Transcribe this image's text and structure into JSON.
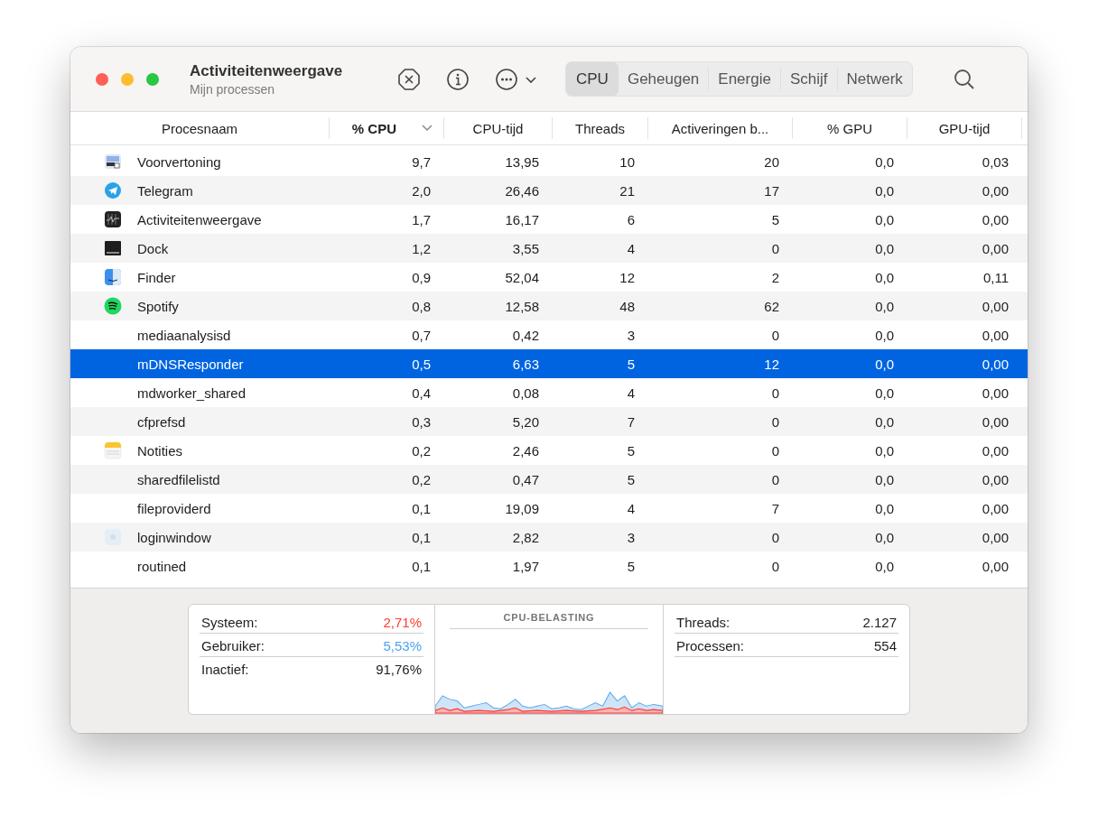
{
  "window": {
    "title": "Activiteitenweergave",
    "subtitle": "Mijn processen"
  },
  "tabs": [
    {
      "label": "CPU",
      "selected": true
    },
    {
      "label": "Geheugen",
      "selected": false
    },
    {
      "label": "Energie",
      "selected": false
    },
    {
      "label": "Schijf",
      "selected": false
    },
    {
      "label": "Netwerk",
      "selected": false
    }
  ],
  "table": {
    "columns": [
      {
        "label": "Procesnaam",
        "sorted": false
      },
      {
        "label": "% CPU",
        "sorted": true
      },
      {
        "label": "CPU-tijd",
        "sorted": false
      },
      {
        "label": "Threads",
        "sorted": false
      },
      {
        "label": "Activeringen b...",
        "sorted": false
      },
      {
        "label": "% GPU",
        "sorted": false
      },
      {
        "label": "GPU-tijd",
        "sorted": false
      }
    ],
    "rows": [
      {
        "kind": "preview",
        "selected": false,
        "cells": [
          "Voorvertoning",
          "9,7",
          "13,95",
          "10",
          "20",
          "0,0",
          "0,03"
        ]
      },
      {
        "kind": "telegram",
        "selected": false,
        "cells": [
          "Telegram",
          "2,0",
          "26,46",
          "21",
          "17",
          "0,0",
          "0,00"
        ]
      },
      {
        "kind": "activity",
        "selected": false,
        "cells": [
          "Activiteitenweergave",
          "1,7",
          "16,17",
          "6",
          "5",
          "0,0",
          "0,00"
        ]
      },
      {
        "kind": "dock",
        "selected": false,
        "cells": [
          "Dock",
          "1,2",
          "3,55",
          "4",
          "0",
          "0,0",
          "0,00"
        ]
      },
      {
        "kind": "finder",
        "selected": false,
        "cells": [
          "Finder",
          "0,9",
          "52,04",
          "12",
          "2",
          "0,0",
          "0,11"
        ]
      },
      {
        "kind": "spotify",
        "selected": false,
        "cells": [
          "Spotify",
          "0,8",
          "12,58",
          "48",
          "62",
          "0,0",
          "0,00"
        ]
      },
      {
        "kind": "plain",
        "selected": false,
        "cells": [
          "mediaanalysisd",
          "0,7",
          "0,42",
          "3",
          "0",
          "0,0",
          "0,00"
        ]
      },
      {
        "kind": "plain",
        "selected": true,
        "cells": [
          "mDNSResponder",
          "0,5",
          "6,63",
          "5",
          "12",
          "0,0",
          "0,00"
        ]
      },
      {
        "kind": "plain",
        "selected": false,
        "cells": [
          "mdworker_shared",
          "0,4",
          "0,08",
          "4",
          "0",
          "0,0",
          "0,00"
        ]
      },
      {
        "kind": "plain",
        "selected": false,
        "cells": [
          "cfprefsd",
          "0,3",
          "5,20",
          "7",
          "0",
          "0,0",
          "0,00"
        ]
      },
      {
        "kind": "notes",
        "selected": false,
        "cells": [
          "Notities",
          "0,2",
          "2,46",
          "5",
          "0",
          "0,0",
          "0,00"
        ]
      },
      {
        "kind": "plain",
        "selected": false,
        "cells": [
          "sharedfilelistd",
          "0,2",
          "0,47",
          "5",
          "0",
          "0,0",
          "0,00"
        ]
      },
      {
        "kind": "plain",
        "selected": false,
        "cells": [
          "fileproviderd",
          "0,1",
          "19,09",
          "4",
          "7",
          "0,0",
          "0,00"
        ]
      },
      {
        "kind": "login",
        "selected": false,
        "cells": [
          "loginwindow",
          "0,1",
          "2,82",
          "3",
          "0",
          "0,0",
          "0,00"
        ]
      },
      {
        "kind": "plain",
        "selected": false,
        "cells": [
          "routined",
          "0,1",
          "1,97",
          "5",
          "0",
          "0,0",
          "0,00"
        ]
      }
    ]
  },
  "summary": {
    "left": [
      {
        "label": "Systeem:",
        "value": "2,71%",
        "color": "#ff3b30"
      },
      {
        "label": "Gebruiker:",
        "value": "5,53%",
        "color": "#4aa3f0"
      },
      {
        "label": "Inactief:",
        "value": "91,76%",
        "color": "#1d1d1f"
      }
    ],
    "graph_title": "CPU-BELASTING",
    "right": [
      {
        "label": "Threads:",
        "value": "2.127"
      },
      {
        "label": "Processen:",
        "value": "554"
      }
    ]
  }
}
